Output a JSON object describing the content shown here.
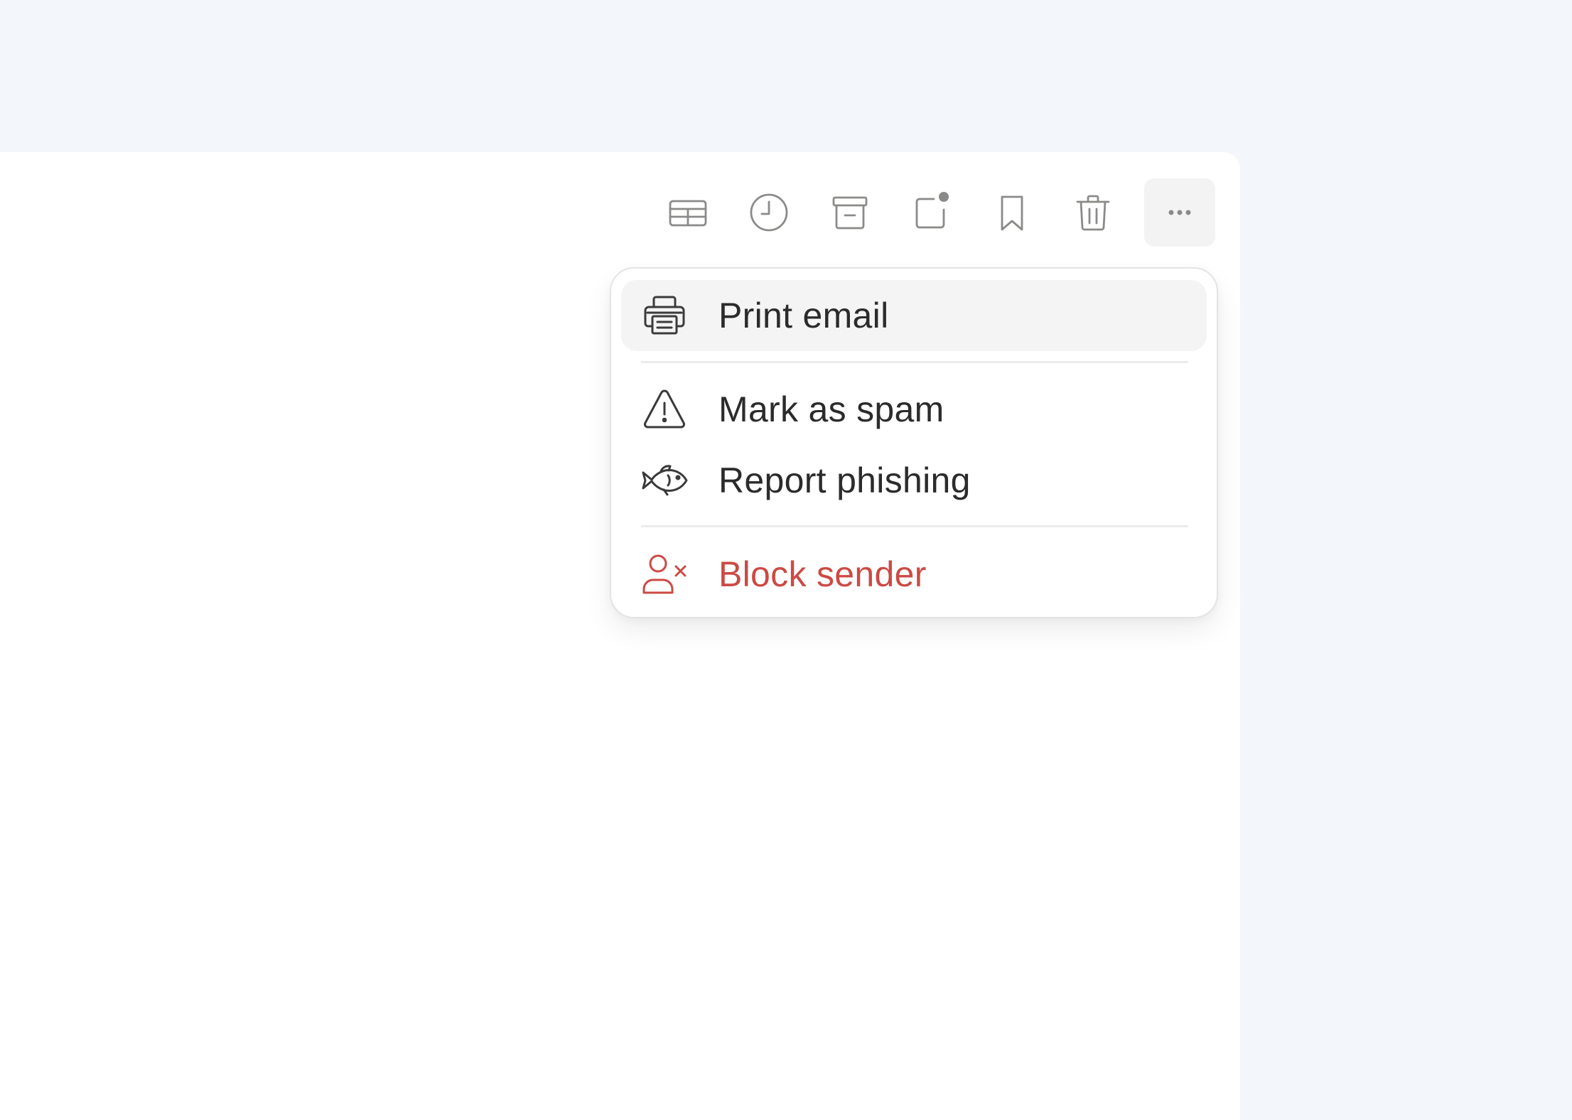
{
  "toolbar": {
    "buttons": [
      {
        "icon": "table-view-icon"
      },
      {
        "icon": "clock-icon"
      },
      {
        "icon": "archive-icon"
      },
      {
        "icon": "mark-unread-icon"
      },
      {
        "icon": "bookmark-icon"
      },
      {
        "icon": "trash-icon"
      },
      {
        "icon": "more-horizontal-icon"
      }
    ]
  },
  "menu": {
    "items": [
      {
        "label": "Print email",
        "icon": "printer-icon"
      },
      {
        "label": "Mark as spam",
        "icon": "warning-triangle-icon"
      },
      {
        "label": "Report phishing",
        "icon": "fish-icon"
      },
      {
        "label": "Block sender",
        "icon": "block-user-icon"
      }
    ]
  },
  "colors": {
    "background": "#f3f7fb",
    "panel": "#ffffff",
    "toolbar_icon": "#8a8a88",
    "menu_text": "#2b2b2b",
    "danger": "#cc4a44",
    "hover": "#f4f4f4"
  }
}
